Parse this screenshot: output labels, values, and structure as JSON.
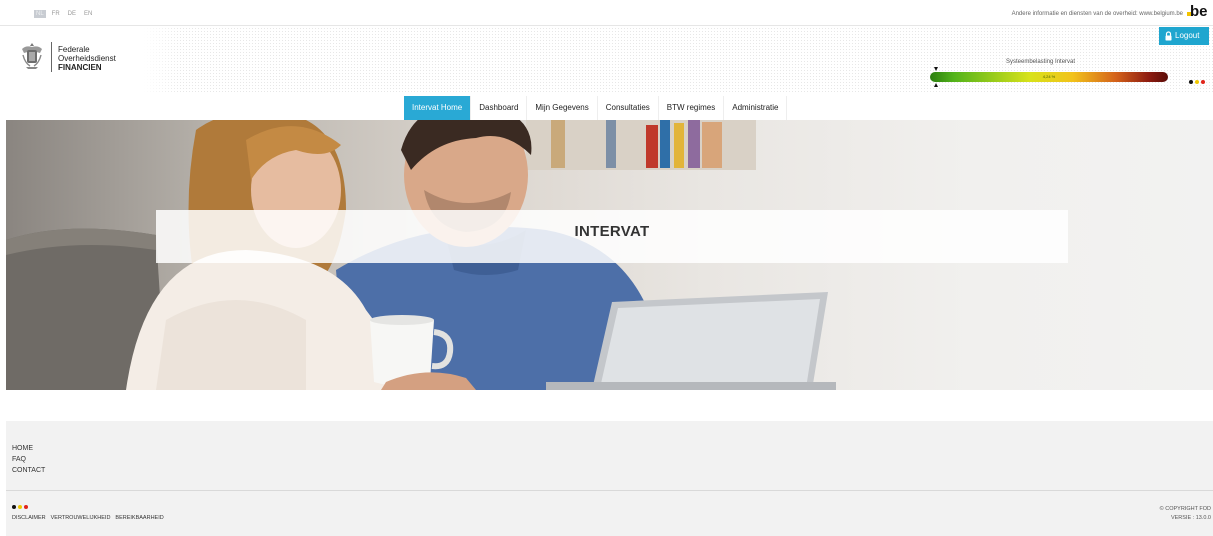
{
  "topbar": {
    "languages": [
      {
        "code": "NL",
        "active": true
      },
      {
        "code": "FR",
        "active": false
      },
      {
        "code": "DE",
        "active": false
      },
      {
        "code": "EN",
        "active": false
      }
    ],
    "gov_info": "Andere informatie en diensten van de overheid: www.belgium.be",
    "be_logo": "be"
  },
  "header": {
    "org_line1": "Federale",
    "org_line2": "Overheidsdienst",
    "org_line3": "FINANCIEN",
    "logout_label": "Logout",
    "load_label": "Systeembelasting Intervat",
    "load_value": "4,24 %",
    "load_percent": 4.24
  },
  "nav": {
    "items": [
      {
        "label": "Intervat Home",
        "active": true
      },
      {
        "label": "Dashboard",
        "active": false
      },
      {
        "label": "Mijn Gegevens",
        "active": false
      },
      {
        "label": "Consultaties",
        "active": false
      },
      {
        "label": "BTW regimes",
        "active": false
      },
      {
        "label": "Administratie",
        "active": false
      }
    ]
  },
  "hero": {
    "title": "INTERVAT"
  },
  "footer": {
    "links": [
      "HOME",
      "FAQ",
      "CONTACT"
    ],
    "legal": [
      "DISCLAIMER",
      "VERTROUWELIJKHEID",
      "BEREIKBAARHEID"
    ],
    "copyright": "© COPYRIGHT FOD",
    "version": "VERSIE : 13.0.0"
  },
  "colors": {
    "accent": "#29a9d5",
    "logout": "#1fa6cf",
    "flag_black": "#111111",
    "flag_yellow": "#f0c800",
    "flag_red": "#e0251b"
  },
  "icons": [
    "belgian-crest-icon",
    "lock-icon",
    "load-marker-icon",
    "flag-dots-icon",
    "be-logo"
  ]
}
